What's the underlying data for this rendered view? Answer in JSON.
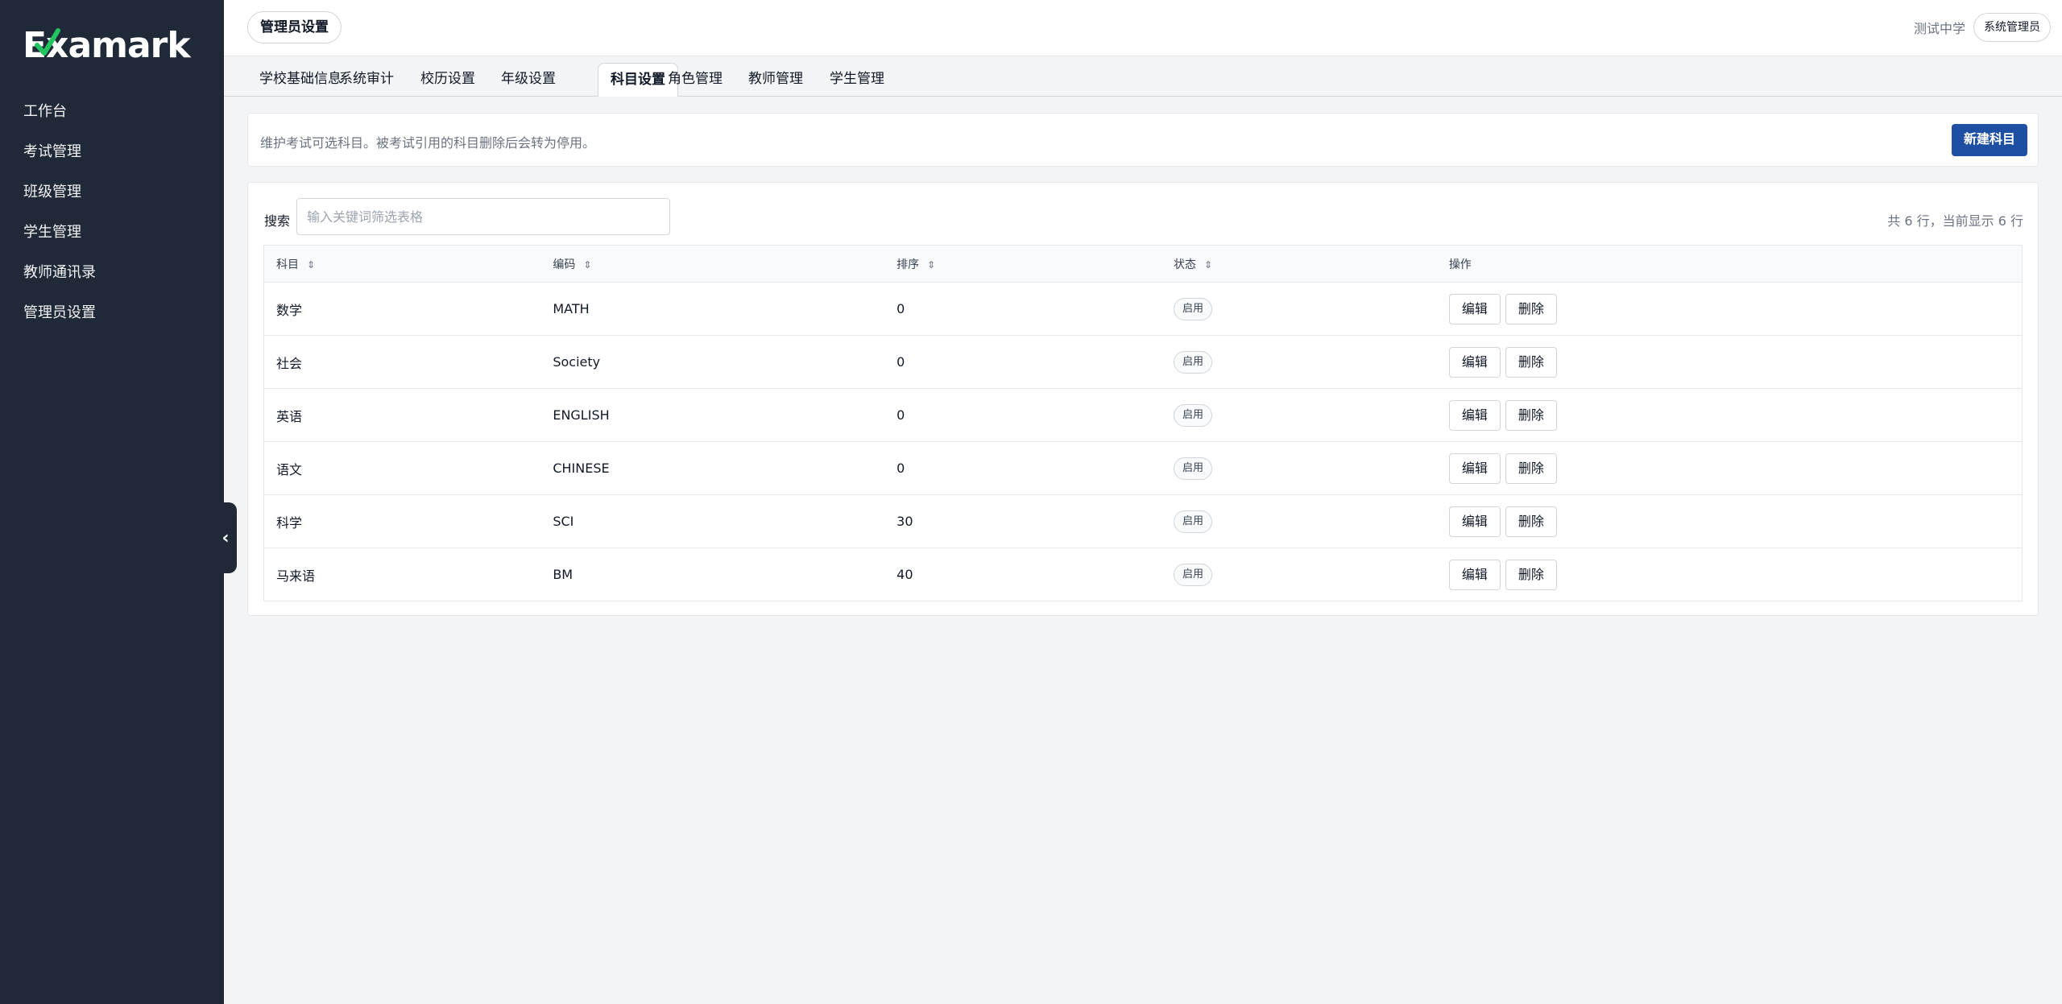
{
  "app": {
    "logo_text": "Examark"
  },
  "sidebar": {
    "items": [
      {
        "label": "工作台"
      },
      {
        "label": "考试管理"
      },
      {
        "label": "班级管理"
      },
      {
        "label": "学生管理"
      },
      {
        "label": "教师通讯录"
      },
      {
        "label": "管理员设置"
      }
    ],
    "collapse_glyph": "‹"
  },
  "header": {
    "title": "管理员设置",
    "school": "测试中学",
    "role": "系统管理员"
  },
  "tabs": [
    {
      "label": "学校基础信息"
    },
    {
      "label": "系统审计"
    },
    {
      "label": "校历设置"
    },
    {
      "label": "年级设置"
    },
    {
      "label": "科目设置",
      "active": true
    },
    {
      "label": "角色管理"
    },
    {
      "label": "教师管理"
    },
    {
      "label": "学生管理"
    }
  ],
  "info": {
    "text": "维护考试可选科目。被考试引用的科目删除后会转为停用。",
    "new_button": "新建科目"
  },
  "search": {
    "label": "搜索",
    "placeholder": "输入关键词筛选表格",
    "value": ""
  },
  "row_count": "共 6 行，当前显示 6 行",
  "table": {
    "columns": [
      "科目",
      "编码",
      "排序",
      "状态",
      "操作"
    ],
    "sort_glyph": "⇕",
    "rows": [
      {
        "subject": "数学",
        "code": "MATH",
        "order": "0",
        "status": "启用"
      },
      {
        "subject": "社会",
        "code": "Society",
        "order": "0",
        "status": "启用"
      },
      {
        "subject": "英语",
        "code": "ENGLISH",
        "order": "0",
        "status": "启用"
      },
      {
        "subject": "语文",
        "code": "CHINESE",
        "order": "0",
        "status": "启用"
      },
      {
        "subject": "科学",
        "code": "SCI",
        "order": "30",
        "status": "启用"
      },
      {
        "subject": "马来语",
        "code": "BM",
        "order": "40",
        "status": "启用"
      }
    ],
    "edit_label": "编辑",
    "delete_label": "删除"
  },
  "colors": {
    "sidebar_bg": "#1f2937",
    "primary": "#1e4fa3",
    "logo_check": "#22c55e"
  }
}
